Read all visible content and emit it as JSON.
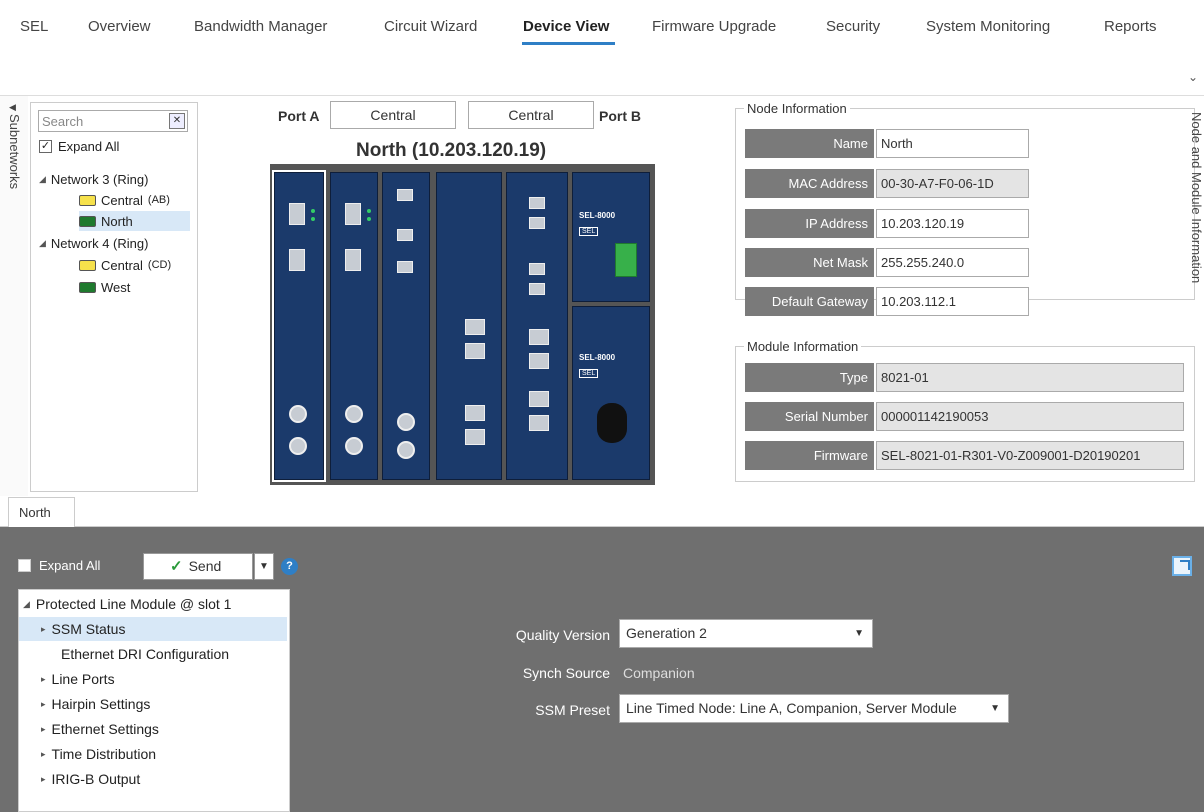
{
  "nav": {
    "tabs": [
      {
        "label": "SEL"
      },
      {
        "label": "Overview"
      },
      {
        "label": "Bandwidth Manager"
      },
      {
        "label": "Circuit Wizard"
      },
      {
        "label": "Device View"
      },
      {
        "label": "Firmware Upgrade"
      },
      {
        "label": "Security"
      },
      {
        "label": "System Monitoring"
      },
      {
        "label": "Reports"
      }
    ],
    "active_tab": "Device View"
  },
  "subnetworks": {
    "strip_label": "Subnetworks",
    "search_placeholder": "Search",
    "expand_all": "Expand All",
    "tree": [
      {
        "label": "Network 3 (Ring)",
        "children": [
          {
            "label": "Central",
            "suffix": "(AB)",
            "color": "#f6e14b"
          },
          {
            "label": "North",
            "suffix": "",
            "color": "#1f7a2e",
            "selected": true
          }
        ]
      },
      {
        "label": "Network 4 (Ring)",
        "children": [
          {
            "label": "Central",
            "suffix": "(CD)",
            "color": "#f6e14b"
          },
          {
            "label": "West",
            "suffix": "",
            "color": "#1f7a2e"
          }
        ]
      }
    ]
  },
  "device": {
    "port_a_label": "Port A",
    "port_a_value": "Central",
    "port_b_label": "Port B",
    "port_b_value": "Central",
    "title": "North (10.203.120.19)",
    "psu_model": "SEL-8000",
    "psu_brand": "SEL"
  },
  "node_info": {
    "legend": "Node Information",
    "side_label": "Node and Module Information",
    "fields": [
      {
        "label": "Name",
        "value": "North"
      },
      {
        "label": "MAC Address",
        "value": "00-30-A7-F0-06-1D"
      },
      {
        "label": "IP Address",
        "value": "10.203.120.19"
      },
      {
        "label": "Net Mask",
        "value": "255.255.240.0"
      },
      {
        "label": "Default Gateway",
        "value": "10.203.112.1"
      }
    ]
  },
  "module_info": {
    "legend": "Module Information",
    "fields": [
      {
        "label": "Type",
        "value": "8021-01"
      },
      {
        "label": "Serial Number",
        "value": "000001142190053"
      },
      {
        "label": "Firmware",
        "value": "SEL-8021-01-R301-V0-Z009001-D20190201"
      }
    ]
  },
  "bottom_tab": "North",
  "config": {
    "expand_all": "Expand All",
    "send_label": "Send",
    "tree": {
      "root": "Protected Line Module @ slot 1",
      "items": [
        {
          "label": "SSM Status"
        },
        {
          "label": "Ethernet DRI Configuration"
        },
        {
          "label": "Line Ports"
        },
        {
          "label": "Hairpin Settings"
        },
        {
          "label": "Ethernet Settings"
        },
        {
          "label": "Time Distribution"
        },
        {
          "label": "IRIG-B Output"
        }
      ]
    },
    "form": {
      "quality_version_label": "Quality Version",
      "quality_version_value": "Generation 2",
      "synch_source_label": "Synch Source",
      "synch_source_value": "Companion",
      "ssm_preset_label": "SSM Preset",
      "ssm_preset_value": "Line Timed Node: Line A, Companion, Server Module"
    }
  },
  "colors": {
    "accent": "#2f7fc6",
    "card_blue": "#1b3a6b",
    "label_gray": "#7a7a7a",
    "lower_panel": "#6f6f6f"
  }
}
